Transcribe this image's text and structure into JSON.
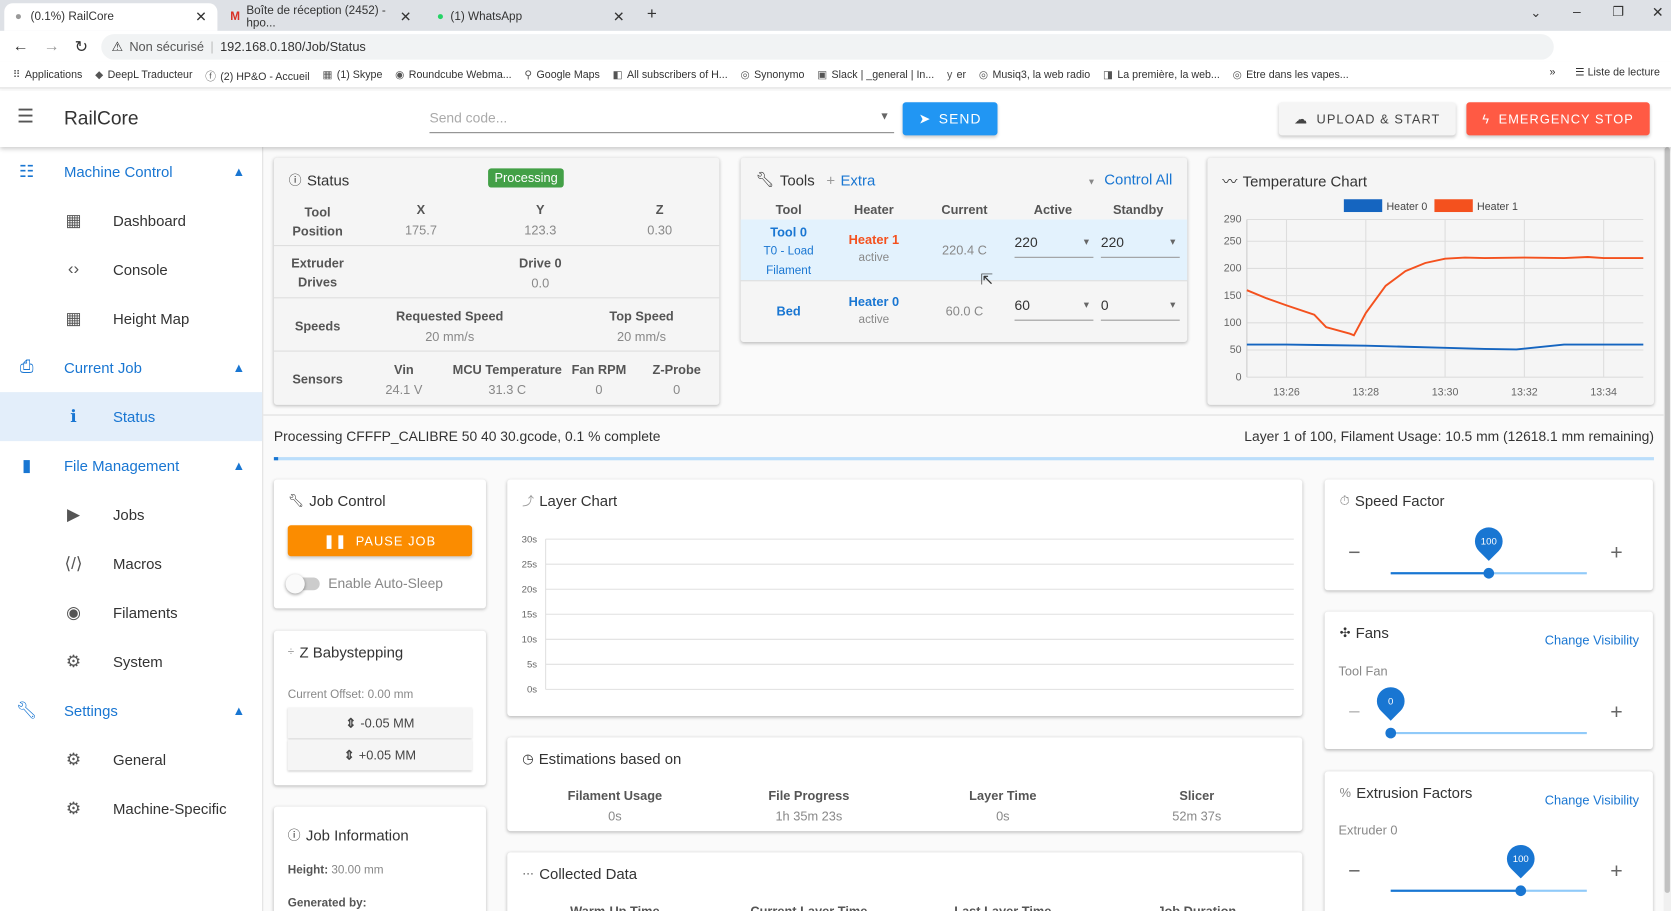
{
  "browser": {
    "tabs": [
      {
        "label": "(0.1%) RailCore"
      },
      {
        "label": "Boîte de réception (2452) - hpo..."
      },
      {
        "label": "(1) WhatsApp"
      }
    ],
    "security": "Non sécurisé",
    "url": "192.168.0.180/Job/Status",
    "bookmarks": [
      "Applications",
      "DeepL Traducteur",
      "(2) HP&O - Accueil",
      "(1) Skype",
      "Roundcube Webma...",
      "Google Maps",
      "All subscribers of H...",
      "Synonymo",
      "Slack | _general | In...",
      "er",
      "Musiq3, la web radio",
      "La première, la web...",
      "Etre dans les vapes..."
    ],
    "reading_list": "Liste de lecture"
  },
  "app": {
    "title": "RailCore",
    "code_placeholder": "Send code...",
    "send": "SEND",
    "upload": "UPLOAD & START",
    "estop": "EMERGENCY STOP",
    "accent": "#1976d2",
    "estop_color": "#f4511e"
  },
  "sidebar": {
    "groups": [
      {
        "label": "Machine Control",
        "icon": "tune-icon",
        "items": [
          {
            "label": "Dashboard",
            "icon": "dashboard-icon"
          },
          {
            "label": "Console",
            "icon": "code-icon"
          },
          {
            "label": "Height Map",
            "icon": "grid-icon"
          }
        ]
      },
      {
        "label": "Current Job",
        "icon": "printer-icon",
        "items": [
          {
            "label": "Status",
            "icon": "info-icon",
            "active": true
          }
        ]
      },
      {
        "label": "File Management",
        "icon": "sd-card-icon",
        "items": [
          {
            "label": "Jobs",
            "icon": "play-icon"
          },
          {
            "label": "Macros",
            "icon": "macro-icon"
          },
          {
            "label": "Filaments",
            "icon": "filament-icon"
          },
          {
            "label": "System",
            "icon": "gear-icon"
          }
        ]
      },
      {
        "label": "Settings",
        "icon": "wrench-icon",
        "items": [
          {
            "label": "General",
            "icon": "gear-icon"
          },
          {
            "label": "Machine-Specific",
            "icon": "gears-icon"
          }
        ]
      }
    ]
  },
  "status": {
    "title": "Status",
    "badge": "Processing",
    "position": {
      "label1": "Tool",
      "label2": "Position",
      "axes": [
        {
          "name": "X",
          "value": "175.7"
        },
        {
          "name": "Y",
          "value": "123.3"
        },
        {
          "name": "Z",
          "value": "0.30"
        }
      ]
    },
    "extruder": {
      "label1": "Extruder",
      "label2": "Drives",
      "name": "Drive 0",
      "value": "0.0"
    },
    "speeds": {
      "label": "Speeds",
      "items": [
        {
          "name": "Requested Speed",
          "value": "20 mm/s"
        },
        {
          "name": "Top Speed",
          "value": "20 mm/s"
        }
      ]
    },
    "sensors": {
      "label": "Sensors",
      "items": [
        {
          "name": "Vin",
          "value": "24.1 V"
        },
        {
          "name": "MCU Temperature",
          "value": "31.3 C"
        },
        {
          "name": "Fan RPM",
          "value": "0"
        },
        {
          "name": "Z-Probe",
          "value": "0"
        }
      ]
    }
  },
  "tools": {
    "title": "Tools",
    "extra": "Extra",
    "control_all": "Control All",
    "headers": [
      "Tool",
      "Heater",
      "Current",
      "Active",
      "Standby"
    ],
    "rows": [
      {
        "tool": "Tool 0",
        "tool_sub": "T0 - Load Filament",
        "heater": "Heater 1",
        "heater_state": "active",
        "current": "220.4 C",
        "active": "220",
        "standby": "220"
      },
      {
        "tool": "Bed",
        "tool_sub": "",
        "heater": "Heater 0",
        "heater_state": "active",
        "current": "60.0 C",
        "active": "60",
        "standby": "0"
      }
    ]
  },
  "temp_chart": {
    "title": "Temperature Chart"
  },
  "chart_data": [
    {
      "type": "line",
      "title": "Temperature Chart",
      "legend": "top",
      "grid": true,
      "x_ticks": [
        "13:26",
        "13:28",
        "13:30",
        "13:32",
        "13:34"
      ],
      "xlim": [
        "13:25",
        "13:35"
      ],
      "y_ticks": [
        0,
        50,
        100,
        150,
        200,
        250,
        290
      ],
      "ylim": [
        0,
        290
      ],
      "series": [
        {
          "name": "Heater 0",
          "color": "#1565c0",
          "points": [
            [
              "13:25",
              60
            ],
            [
              "13:26",
              60
            ],
            [
              "13:27",
              59
            ],
            [
              "13:28",
              58
            ],
            [
              "13:29",
              56
            ],
            [
              "13:30",
              54
            ],
            [
              "13:31",
              52
            ],
            [
              "13:31.8",
              51
            ],
            [
              "13:32.2",
              54
            ],
            [
              "13:33",
              60
            ],
            [
              "13:34",
              60
            ],
            [
              "13:35",
              60
            ]
          ]
        },
        {
          "name": "Heater 1",
          "color": "#f4511e",
          "points": [
            [
              "13:25",
              160
            ],
            [
              "13:25.5",
              145
            ],
            [
              "13:26",
              132
            ],
            [
              "13:26.7",
              115
            ],
            [
              "13:27",
              92
            ],
            [
              "13:27.6",
              80
            ],
            [
              "13:27.7",
              77
            ],
            [
              "13:28",
              118
            ],
            [
              "13:28.5",
              168
            ],
            [
              "13:29",
              195
            ],
            [
              "13:29.5",
              210
            ],
            [
              "13:30",
              218
            ],
            [
              "13:30.5",
              220
            ],
            [
              "13:31",
              219
            ],
            [
              "13:32",
              220
            ],
            [
              "13:33",
              219
            ],
            [
              "13:33.6",
              221
            ],
            [
              "13:34",
              219
            ],
            [
              "13:35",
              219
            ]
          ]
        }
      ]
    },
    {
      "type": "line",
      "title": "Layer Chart",
      "y_ticks": [
        "0s",
        "5s",
        "10s",
        "15s",
        "20s",
        "25s",
        "30s"
      ],
      "ylim": [
        0,
        30
      ],
      "series": []
    }
  ],
  "progress": {
    "left": "Processing CFFFP_CALIBRE 50 40 30.gcode, 0.1 % complete",
    "right": "Layer 1 of 100, Filament Usage: 10.5 mm (12618.1 mm remaining)",
    "percent": 0.1
  },
  "job_control": {
    "title": "Job Control",
    "pause": "PAUSE JOB",
    "autosleep": "Enable Auto-Sleep",
    "autosleep_on": false
  },
  "babystep": {
    "title": "Z Babystepping",
    "offset": "Current Offset: 0.00 mm",
    "minus": "-0.05 MM",
    "plus": "+0.05 MM"
  },
  "job_info": {
    "title": "Job Information",
    "height_label": "Height:",
    "height": "30.00 mm",
    "generated_label": "Generated by:"
  },
  "layer_chart": {
    "title": "Layer Chart"
  },
  "estimations": {
    "title": "Estimations based on",
    "items": [
      {
        "name": "Filament Usage",
        "value": "0s"
      },
      {
        "name": "File Progress",
        "value": "1h 35m 23s"
      },
      {
        "name": "Layer Time",
        "value": "0s"
      },
      {
        "name": "Slicer",
        "value": "52m 37s"
      }
    ]
  },
  "collected": {
    "title": "Collected Data",
    "headers": [
      "Warm-Up Time",
      "Current Layer Time",
      "Last Layer Time",
      "Job Duration"
    ]
  },
  "speed_factor": {
    "title": "Speed Factor",
    "value": 100,
    "min": 1,
    "max": 200
  },
  "fans": {
    "title": "Fans",
    "change": "Change Visibility",
    "fan": "Tool Fan",
    "value": 0
  },
  "extrusion": {
    "title": "Extrusion Factors",
    "change": "Change Visibility",
    "extruder": "Extruder 0",
    "value": 100,
    "min": 1,
    "max": 150
  }
}
